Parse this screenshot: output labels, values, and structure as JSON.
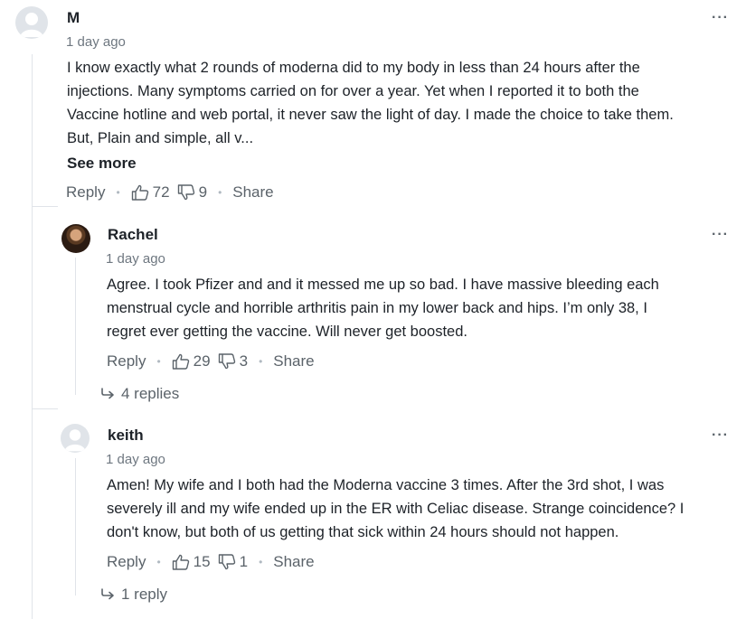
{
  "comments": [
    {
      "author": "M",
      "time": "1 day ago",
      "body_lines": [
        "I know exactly what 2 rounds of moderna did to my body in less than 24 hours after the",
        "injections. Many symptoms carried on for over a year. Yet when I reported it to both the",
        "Vaccine hotline and web portal, it never saw the light of day. I made the choice to take them.",
        "But, Plain and simple, all v..."
      ],
      "see_more": "See more",
      "reply_label": "Reply",
      "likes": "72",
      "dislikes": "9",
      "share_label": "Share",
      "menu": "···"
    },
    {
      "author": "Rachel",
      "time": "1 day ago",
      "body_lines": [
        "Agree. I took Pfizer and and it messed me up so bad. I have massive bleeding each",
        "menstrual cycle and horrible arthritis pain in my lower back and hips. I’m only 38, I",
        "regret ever getting the vaccine. Will never get boosted."
      ],
      "reply_label": "Reply",
      "likes": "29",
      "dislikes": "3",
      "share_label": "Share",
      "replies_label": "4 replies",
      "menu": "···"
    },
    {
      "author": "keith",
      "time": "1 day ago",
      "body_lines": [
        "Amen! My wife and I both had the Moderna vaccine 3 times. After the 3rd shot, I was",
        "severely ill and my wife ended up in the ER with Celiac disease. Strange coincidence? I",
        "don't know, but both of us getting that sick within 24 hours should not happen."
      ],
      "reply_label": "Reply",
      "likes": "15",
      "dislikes": "1",
      "share_label": "Share",
      "replies_label": "1 reply",
      "menu": "···"
    }
  ],
  "icons": {
    "thumbs_up": "thumbs-up-icon",
    "thumbs_down": "thumbs-down-icon",
    "reply_arrow": "reply-arrow-icon",
    "avatar_placeholder": "user-avatar-icon"
  },
  "colors": {
    "text": "#1d2228",
    "muted": "#5b636a",
    "time": "#6e7780",
    "line": "#e0e4e9"
  }
}
